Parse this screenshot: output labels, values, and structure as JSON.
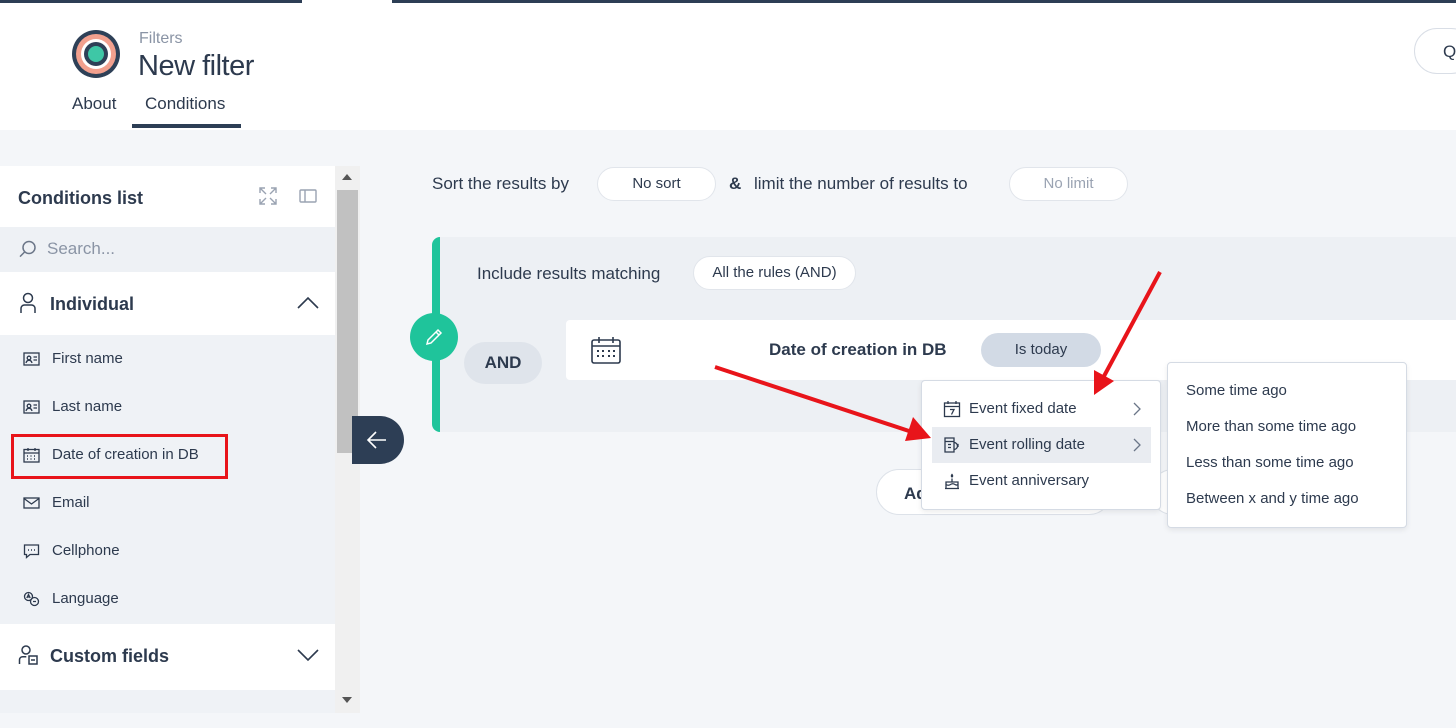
{
  "header": {
    "breadcrumb": "Filters",
    "title": "New filter",
    "tabs": [
      {
        "label": "About",
        "active": false
      },
      {
        "label": "Conditions",
        "active": true
      }
    ],
    "right_button_label": "Q"
  },
  "sidebar": {
    "title": "Conditions list",
    "search_placeholder": "Search...",
    "groups": [
      {
        "label": "Individual",
        "icon": "person-icon",
        "expanded": true,
        "items": [
          {
            "label": "First name",
            "icon": "id-card-icon"
          },
          {
            "label": "Last name",
            "icon": "id-card-icon"
          },
          {
            "label": "Date of creation in DB",
            "icon": "calendar-icon",
            "highlighted": true
          },
          {
            "label": "Email",
            "icon": "envelope-icon"
          },
          {
            "label": "Cellphone",
            "icon": "message-icon"
          },
          {
            "label": "Language",
            "icon": "language-icon"
          }
        ]
      },
      {
        "label": "Custom fields",
        "icon": "custom-fields-icon",
        "expanded": false
      }
    ]
  },
  "main": {
    "sort_label": "Sort the results by",
    "sort_value": "No sort",
    "amp": "&",
    "limit_label": "limit the number of results to",
    "limit_placeholder": "No limit",
    "include_label": "Include results matching",
    "match_mode": "All the rules (AND)",
    "operator_badge": "AND",
    "condition": {
      "name": "Date of creation in DB",
      "operator": "Is today"
    },
    "add_button_label": "Ad"
  },
  "menu": {
    "items": [
      {
        "label": "Event fixed date",
        "icon": "calendar-seven-icon",
        "has_submenu": true
      },
      {
        "label": "Event rolling date",
        "icon": "rolling-date-icon",
        "has_submenu": true,
        "active": true
      },
      {
        "label": "Event anniversary",
        "icon": "cake-icon",
        "has_submenu": false
      }
    ]
  },
  "submenu": {
    "items": [
      {
        "label": "Some time ago"
      },
      {
        "label": "More than some time ago"
      },
      {
        "label": "Less than some time ago"
      },
      {
        "label": "Between x and y time ago"
      }
    ]
  },
  "colors": {
    "accent_green": "#1fc49b",
    "navy": "#2d3e55",
    "highlight_red": "#e8141a",
    "operator_pill": "#d2dae5"
  }
}
